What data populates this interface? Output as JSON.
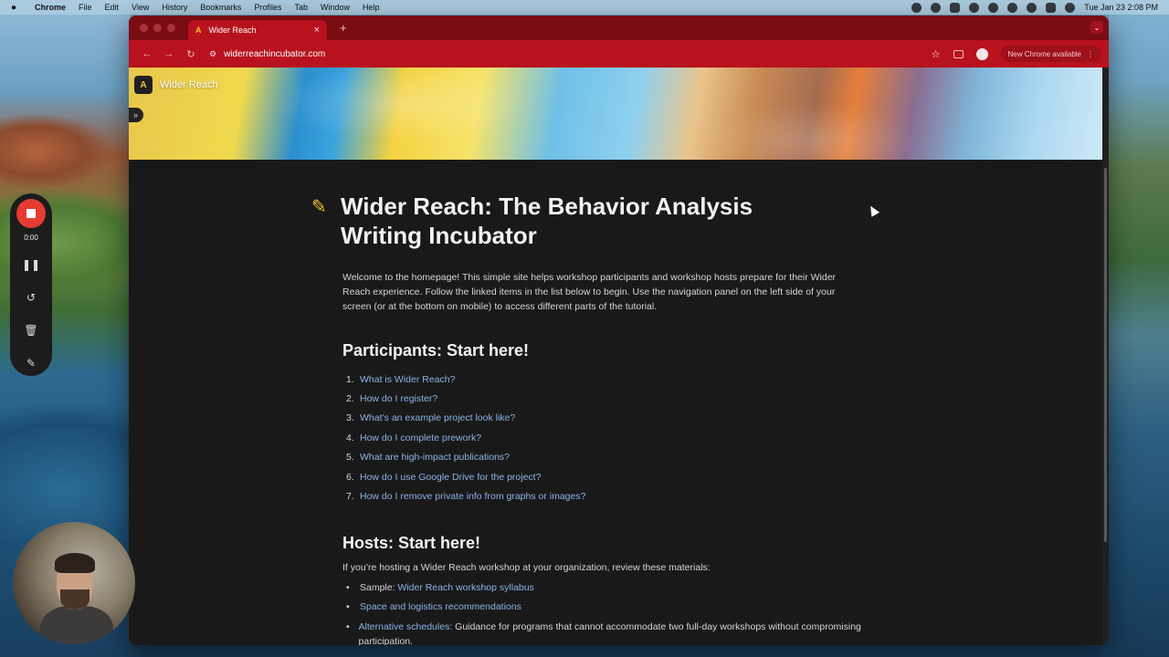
{
  "menubar": {
    "app": "Chrome",
    "items": [
      "File",
      "Edit",
      "View",
      "History",
      "Bookmarks",
      "Profiles",
      "Tab",
      "Window",
      "Help"
    ],
    "datetime": "Tue Jan 23  2:08 PM"
  },
  "browser": {
    "tab_title": "Wider Reach",
    "tab_favicon": "A",
    "new_tab": "+",
    "url": "widerreachincubator.com",
    "update_chip": "New Chrome available",
    "accent": "#b8121e"
  },
  "page": {
    "crumb_logo": "A",
    "crumb_name": "Wider Reach",
    "title_emoji": "✎",
    "title_line1": "Wider Reach: The Behavior Analysis",
    "title_line2": "Writing Incubator",
    "intro": "Welcome to the homepage! This simple site helps workshop participants and workshop hosts prepare for their Wider Reach experience. Follow the linked items in the list below to begin. Use the navigation panel on the left side of your screen (or at the bottom on mobile) to access different parts of the tutorial.",
    "participants_heading": "Participants: Start here!",
    "participants_items": [
      {
        "num": "1.",
        "label": "What is Wider Reach?"
      },
      {
        "num": "2.",
        "label": "How do I register?"
      },
      {
        "num": "3.",
        "label": "What’s an example project look like?"
      },
      {
        "num": "4.",
        "label": "How do I complete prework?"
      },
      {
        "num": "5.",
        "label": "What are high-impact publications?"
      },
      {
        "num": "6.",
        "label": "How do I use Google Drive for the project?"
      },
      {
        "num": "7.",
        "label": "How do I remove private info from graphs or images?"
      }
    ],
    "hosts_heading": "Hosts: Start here!",
    "hosts_intro": "If you’re hosting a Wider Reach workshop at your organization, review these materials:",
    "hosts_items": [
      {
        "prefix": "Sample: ",
        "link": "Wider Reach workshop syllabus",
        "suffix": ""
      },
      {
        "prefix": "",
        "link": "Space and logistics recommendations",
        "suffix": ""
      },
      {
        "prefix": "",
        "link": "Alternative schedules:",
        "suffix": " Guidance for programs that cannot accommodate two full-day workshops without compromising participation."
      }
    ]
  },
  "recorder": {
    "time": "0:00"
  }
}
